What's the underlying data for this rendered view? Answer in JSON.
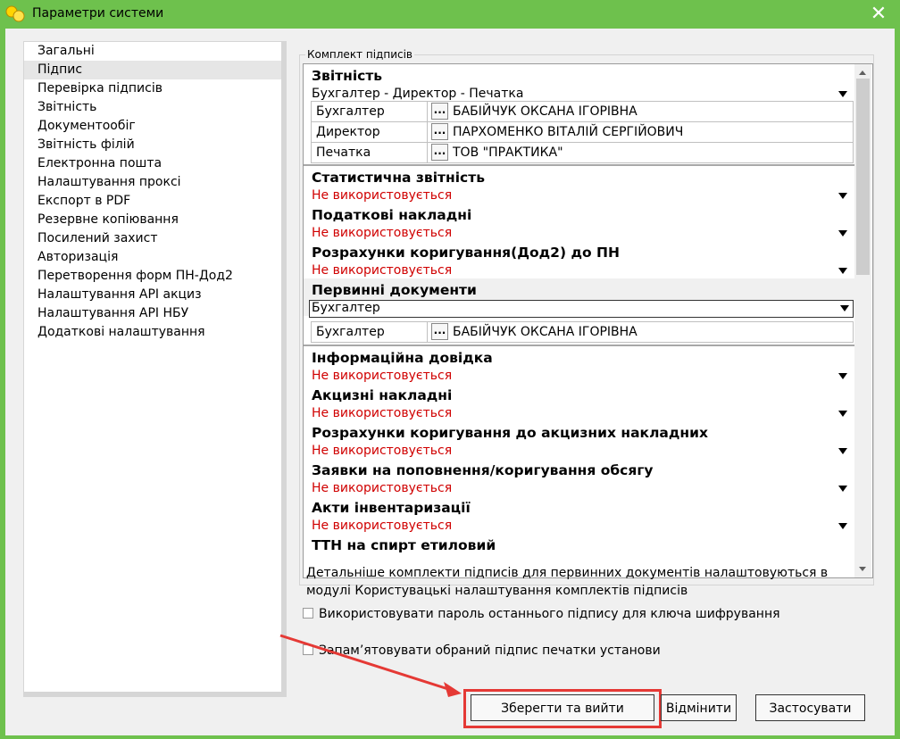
{
  "window": {
    "title": "Параметри системи",
    "close_glyph": "✕"
  },
  "sidebar": {
    "items": [
      {
        "label": "Загальні"
      },
      {
        "label": "Підпис",
        "active": true
      },
      {
        "label": "Перевірка підписів"
      },
      {
        "label": "Звітність"
      },
      {
        "label": "Документообіг"
      },
      {
        "label": "Звітність філій"
      },
      {
        "label": "Електронна пошта"
      },
      {
        "label": "Налаштування проксі"
      },
      {
        "label": "Експорт в PDF"
      },
      {
        "label": "Резервне копіювання"
      },
      {
        "label": "Посилений захист"
      },
      {
        "label": "Авторизація"
      },
      {
        "label": "Перетворення форм ПН-Дод2"
      },
      {
        "label": "Налаштування API акциз"
      },
      {
        "label": "Налаштування API НБУ"
      },
      {
        "label": "Додаткові налаштування"
      }
    ]
  },
  "group": {
    "label": "Комплект підписів",
    "sections": {
      "zvitnist": {
        "title": "Звітність",
        "value": "Бухгалтер - Директор - Печатка"
      },
      "signers1": [
        {
          "role": "Бухгалтер",
          "button": "...",
          "name": "БАБІЙЧУК ОКСАНА ІГОРІВНА"
        },
        {
          "role": "Директор",
          "button": "...",
          "name": "ПАРХОМЕНКО ВІТАЛІЙ СЕРГІЙОВИЧ"
        },
        {
          "role": "Печатка",
          "button": "...",
          "name": "ТОВ \"ПРАКТИКА\""
        }
      ],
      "stat": {
        "title": "Статистична звітність",
        "value": "Не використовується"
      },
      "podatkovi": {
        "title": "Податкові накладні",
        "value": "Не використовується"
      },
      "rozrakhunky": {
        "title": "Розрахунки коригування(Дод2) до ПН",
        "value": "Не використовується"
      },
      "pervynni": {
        "title": "Первинні документи",
        "value": "Бухгалтер"
      },
      "signers2": [
        {
          "role": "Бухгалтер",
          "button": "...",
          "name": "БАБІЙЧУК ОКСАНА ІГОРІВНА"
        }
      ],
      "info": {
        "title": "Інформаційна довідка",
        "value": "Не використовується"
      },
      "aktsyzni": {
        "title": "Акцизні накладні",
        "value": "Не використовується"
      },
      "rozr_aktsyz": {
        "title": "Розрахунки коригування до акцизних накладних",
        "value": "Не використовується"
      },
      "zayavky": {
        "title": "Заявки на поповнення/коригування обсягу",
        "value": "Не використовується"
      },
      "akty": {
        "title": "Акти інвентаризації",
        "value": "Не використовується"
      },
      "ttn": {
        "title": "ТТН на спирт етиловий"
      }
    }
  },
  "note": "Детальніше комплекти підписів для первинних документів налаштовуються в модулі Користувацькі налаштування комплектів підписів",
  "checkboxes": {
    "use_last_password": {
      "label": "Використовувати пароль останнього підпису для ключа шифрування",
      "checked": false
    },
    "remember_stamp": {
      "label": "Запам’ятовувати обраний підпис печатки установи",
      "checked": false
    }
  },
  "buttons": {
    "save_exit": "Зберегти та вийти",
    "cancel": "Відмінити",
    "apply": "Застосувати"
  },
  "colors": {
    "frame": "#6ec14d",
    "highlight": "#e53935",
    "unused_text": "#d00000"
  }
}
